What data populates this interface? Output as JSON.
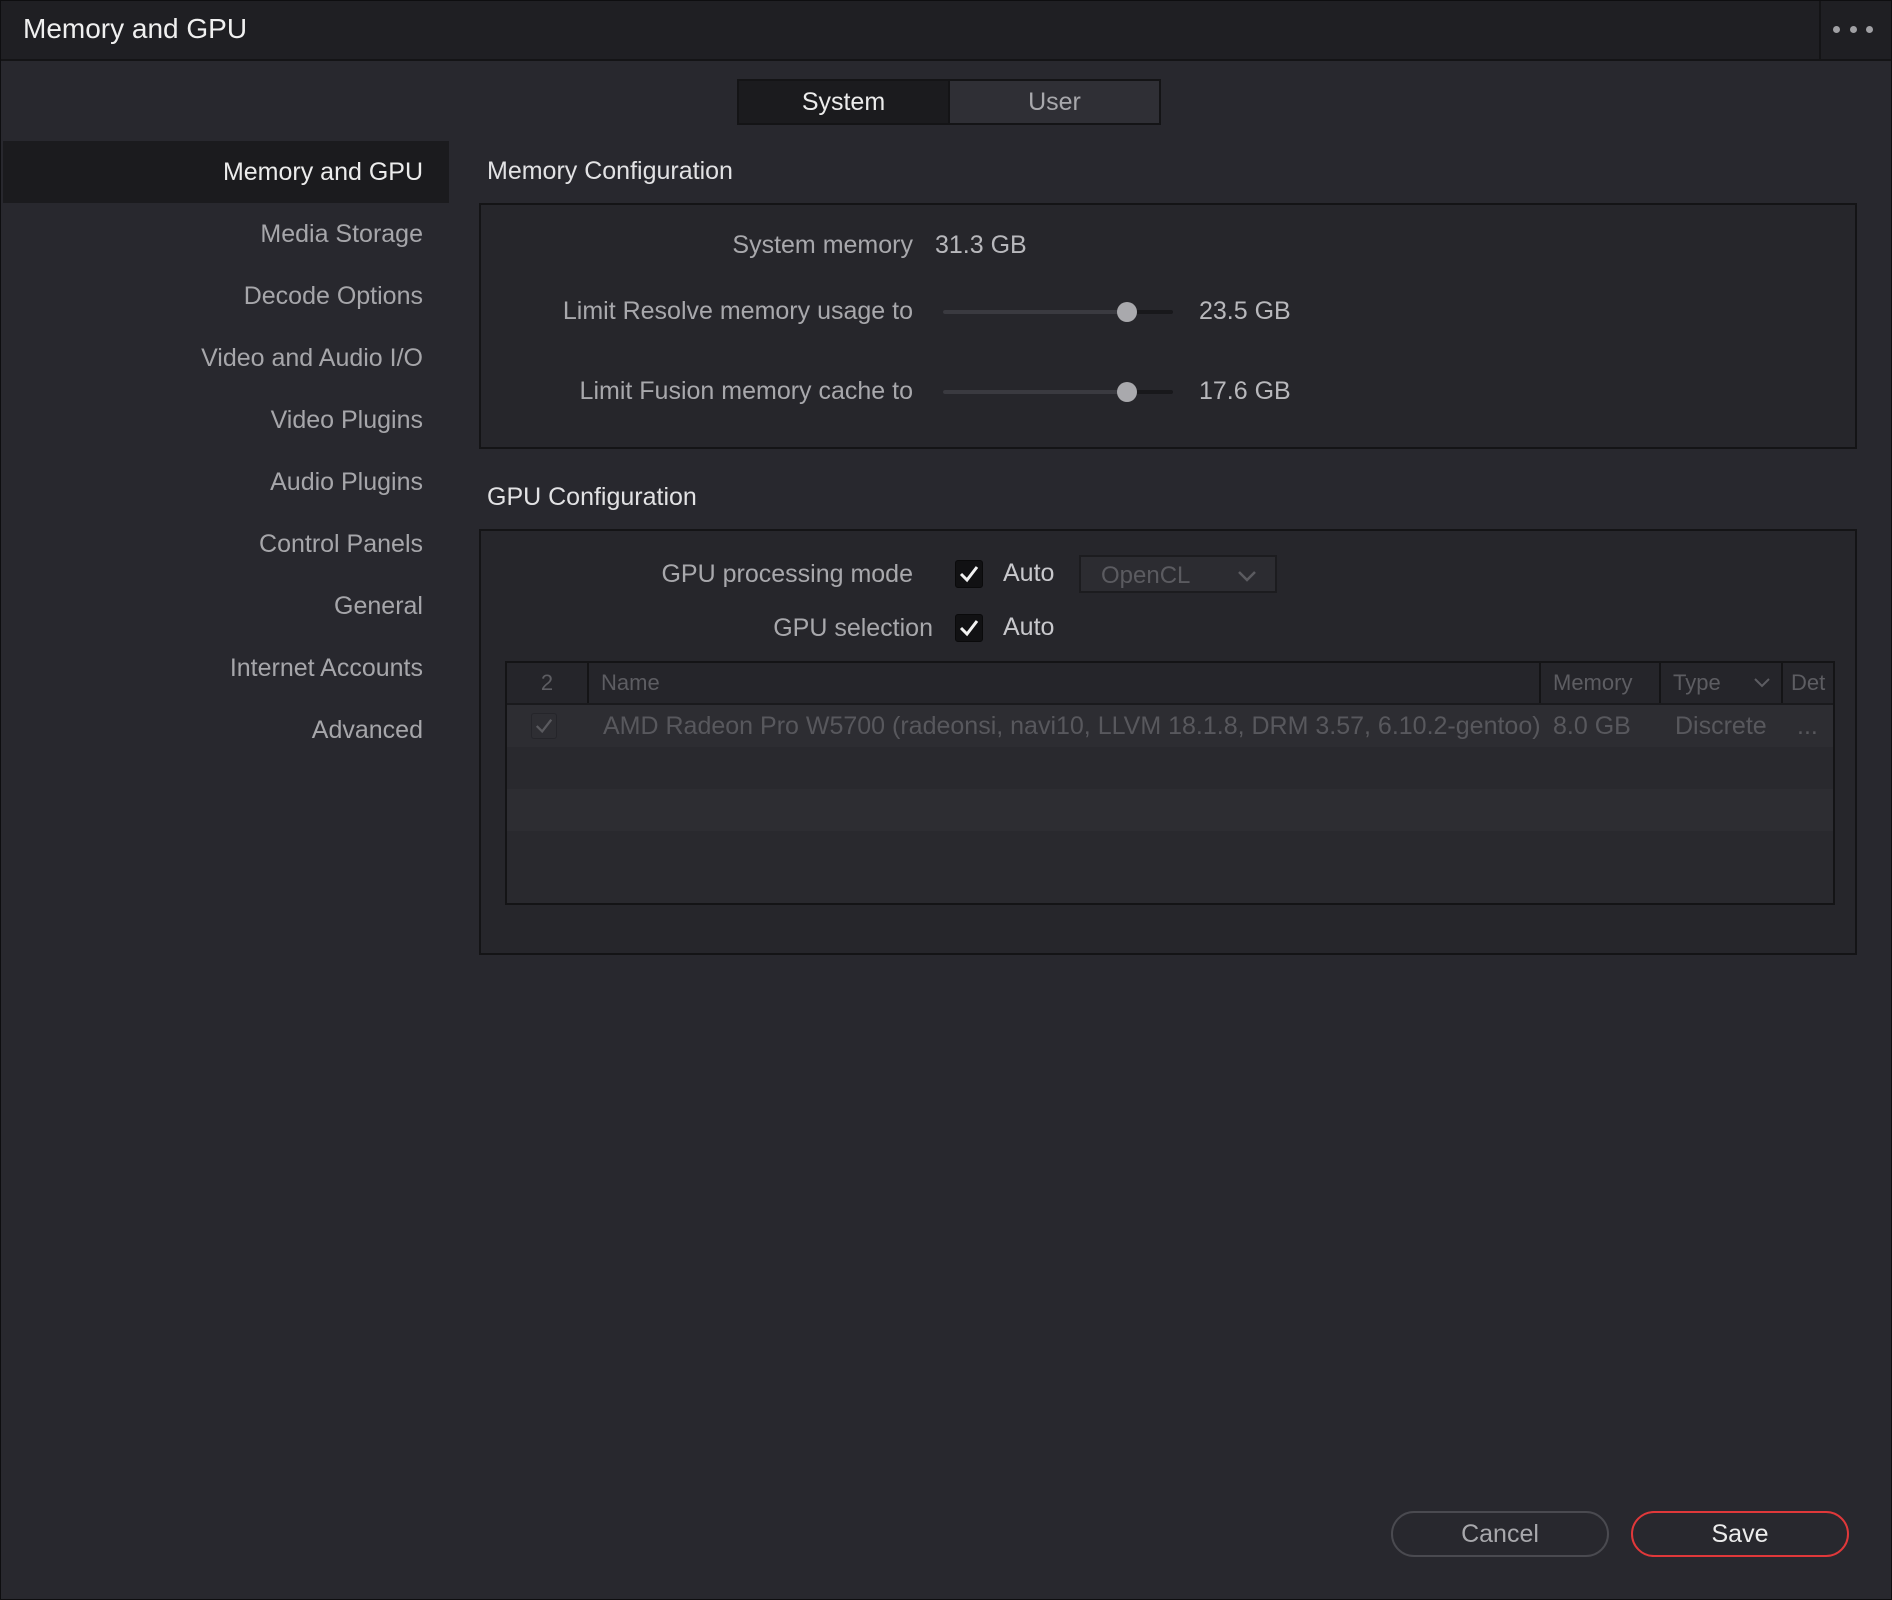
{
  "window": {
    "title": "Memory and GPU",
    "menu_icon": "more-dots-icon"
  },
  "tabs": [
    {
      "label": "System",
      "active": true
    },
    {
      "label": "User",
      "active": false
    }
  ],
  "sidebar": {
    "items": [
      {
        "label": "Memory and GPU",
        "active": true
      },
      {
        "label": "Media Storage",
        "active": false
      },
      {
        "label": "Decode Options",
        "active": false
      },
      {
        "label": "Video and Audio I/O",
        "active": false
      },
      {
        "label": "Video Plugins",
        "active": false
      },
      {
        "label": "Audio Plugins",
        "active": false
      },
      {
        "label": "Control Panels",
        "active": false
      },
      {
        "label": "General",
        "active": false
      },
      {
        "label": "Internet Accounts",
        "active": false
      },
      {
        "label": "Advanced",
        "active": false
      }
    ]
  },
  "memory": {
    "section_title": "Memory Configuration",
    "system_memory_label": "System memory",
    "system_memory_value": "31.3 GB",
    "resolve_limit_label": "Limit Resolve memory usage to",
    "resolve_limit_value": "23.5 GB",
    "resolve_limit_fraction": 0.8,
    "fusion_cache_label": "Limit Fusion memory cache to",
    "fusion_cache_value": "17.6 GB",
    "fusion_cache_fraction": 0.8
  },
  "gpu": {
    "section_title": "GPU Configuration",
    "processing_mode_label": "GPU processing mode",
    "processing_mode_auto_checked": true,
    "processing_mode_auto_label": "Auto",
    "processing_mode_value": "OpenCL",
    "selection_label": "GPU selection",
    "selection_auto_checked": true,
    "selection_auto_label": "Auto",
    "table": {
      "columns": {
        "index": "2",
        "name": "Name",
        "memory": "Memory",
        "type": "Type",
        "details": "Det"
      },
      "rows": [
        {
          "checked": true,
          "name": "AMD Radeon Pro W5700 (radeonsi, navi10, LLVM 18.1.8, DRM 3.57, 6.10.2-gentoo)",
          "memory": "8.0 GB",
          "type": "Discrete",
          "details": "..."
        }
      ]
    }
  },
  "footer": {
    "cancel_label": "Cancel",
    "save_label": "Save"
  },
  "colors": {
    "accent_save_border": "#e0383a",
    "background": "#28282e"
  }
}
